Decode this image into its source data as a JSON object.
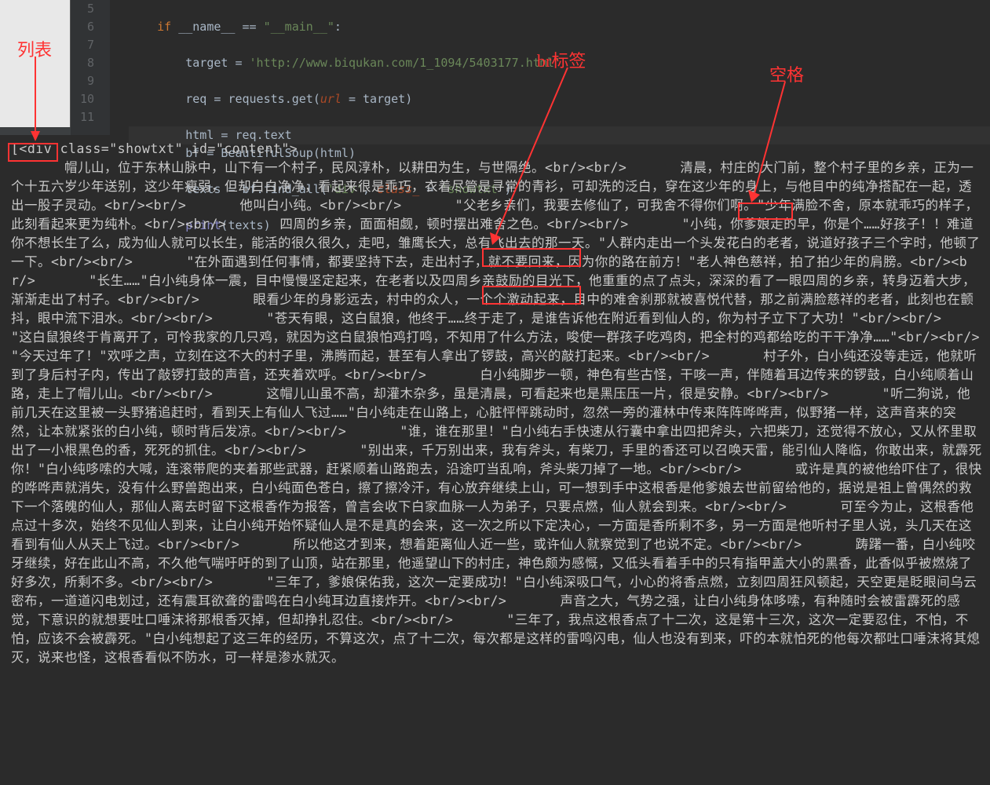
{
  "annotations": {
    "list_label": "列表",
    "br_label": "br标签",
    "space_label": "空格"
  },
  "editor": {
    "lines": {
      "l5": {
        "num": "5",
        "indent": "    ",
        "kw_if": "if",
        "name": " __name__ ",
        "eqeq": "==",
        "main": " \"__main__\"",
        "colon": ":"
      },
      "l6": {
        "num": "6",
        "indent": "        ",
        "var": "target ",
        "eq": "= ",
        "str": "'http://www.biqukan.com/1_1094/5403177.html'"
      },
      "l7": {
        "num": "7",
        "indent": "        ",
        "var": "req ",
        "eq": "= ",
        "mod": "requests",
        "dot": ".",
        "fn": "get",
        "lp": "(",
        "param": "url",
        "eq2": " = ",
        "arg": "target",
        "rp": ")"
      },
      "l8": {
        "num": "8",
        "indent": "        ",
        "var": "html ",
        "eq": "= ",
        "obj": "req",
        "dot": ".",
        "attr": "text"
      },
      "l9": {
        "num": "9",
        "indent": "        ",
        "var": "bf ",
        "eq": "= ",
        "cls": "BeautifulSoup",
        "lp": "(",
        "arg": "html",
        "rp": ")"
      },
      "l10": {
        "num": "10",
        "indent": "        ",
        "var": "texts ",
        "eq": "= ",
        "obj": "bf",
        "dot": ".",
        "fn": "find_all",
        "lp": "(",
        "s1": "'div'",
        "comma": ", ",
        "param": "class_",
        "eq2": " = ",
        "s2": "'showtxt'",
        "rp": ")"
      },
      "l11": {
        "num": "11",
        "indent": "        ",
        "fn": "print",
        "lp": "(",
        "arg": "texts",
        "rp": ")"
      }
    }
  },
  "console": {
    "open": "[<div class=\"showtxt\" id=\"content\">",
    "body_parts": [
      "　　　　帽儿山，位于东林山脉中，山下有一个村子，民风淳朴，以耕田为生，与世隔绝。<br/><br/>　　　　清晨，村庄的大门前，整个村子里的乡亲，正为一个十五六岁少年送别，这少年瘦弱，但却白白净净，看起来很是乖巧，衣着尽管是寻常的青衫，可却洗的泛白，穿在这少年的身上，与他目中的纯净搭配在一起，透出一股子灵动。<br/><br/>　　　　他叫白小纯。<br/><br/>　　　　\"父老乡亲们，我要去修仙了，可我舍不得你们啊。\"少年满脸不舍，原本就乖巧的样子，此刻看起来更为纯朴。<br/><br/>　　　　四周的乡亲，面面相觑，顿时摆出难舍之色。",
      "<br/><br/>",
      "　　　　\"小纯，你爹娘走的早，你是个……好孩子！！难道你不想长生了么，成为仙人就可以长生，能活的很久很久，走吧，雏鹰长大，总有飞出去的那一天。\"人群内走出一个头发花白的老者，说道好孩子三个字时，他顿了一下。<br/><br/>　　　　\"在外面遇到任何事情，都要坚持下去，走出村子，就不要回来，因为你的路在前方！\"老人神色慈祥，拍了拍少年的肩膀。",
      "<br/><br/>",
      "　　　　\"长生……\"白小纯身体一震，目中慢慢坚定起来，在老者以及四周乡亲鼓励的目光下，他重重的点了点头，深深的看了一眼四周的乡亲，转身迈着大步，渐渐走出了村子。<br/><br/>　　　　眼看少年的身影远去，村中的众人，一个个激动起来，目中的难舍刹那就被喜悦代替，那之前满脸慈祥的老者，此刻也在颤抖，眼中流下泪水。<br/><br/>",
      "　　　　\"苍天有眼，这白鼠狼，他终于……终于走了，是谁告诉他在附近看到仙人的，你为村子立下了大功！\"<br/><br/>　　　　\"这白鼠狼终于肯离开了，可怜我家的几只鸡，就因为这白鼠狼怕鸡打鸣，不知用了什么方法，唆使一群孩子吃鸡肉，把全村的鸡都给吃的干干净净……\"<br/><br/>",
      "　　　　\"今天过年了！\"欢呼之声，立刻在这不大的村子里，沸腾而起，甚至有人拿出了锣鼓，高兴的敲打起来。<br/><br/>　　　　村子外，白小纯还没等走远，他就听到了身后村子内，传出了敲锣打鼓的声音，还夹着欢呼。<br/><br/>　　　　白小纯脚步一顿，神色有些古怪，干咳一声，伴随着耳边传来的锣鼓，白小纯顺着山路，走上了帽儿山。<br/><br/>",
      "　　　　这帽儿山虽不高，却灌木杂多，虽是清晨，可看起来也是黑压压一片，很是安静。<br/><br/>　　　　\"听二狗说，他前几天在这里被一头野猪追赶时，看到天上有仙人飞过……\"白小纯走在山路上，心脏怦怦跳动时，忽然一旁的灌林中传来阵阵哗哗声，似野猪一样，这声音来的突然，让本就紧张的白小纯，顿时背后发凉。<br/><br/>　　　　\"谁，谁在那里！\"白小纯右手快速从行囊中拿出四把斧头，六把柴刀，还觉得不放心，又从怀里取出了一小根黑色的香，死死的抓住。<br/><br/>　　　　\"别出来，千万别出来，我有斧头，有柴刀，手里的香还可以召唤天雷，能引仙人降临，你敢出来，就霹死你！\"白小纯哆嗦的大喊，连滚带爬的夹着那些武器，赶紧顺着山路跑去，沿途叮当乱响，斧头柴刀掉了一地。<br/><br/>　　　　或许是真的被他给吓住了，很快的哗哗声就消失，没有什么野兽跑出来，白小纯面色苍白，擦了擦冷汗，有心放弃继续上山，可一想到手中这根香是他爹娘去世前留给他的，据说是祖上曾偶然的救下一个落魄的仙人，那仙人离去时留下这根香作为报答，曾言会收下白家血脉一人为弟子，只要点燃，仙人就会到来。<br/><br/>　　　　可至今为止，这根香他点过十多次，始终不见仙人到来，让白小纯开始怀疑仙人是不是真的会来，这一次之所以下定决心，一方面是香所剩不多，另一方面是他听村子里人说，头几天在这看到有仙人从天上飞过。<br/><br/>　　　　所以他这才到来，想着距离仙人近一些，或许仙人就察觉到了也说不定。<br/><br/>　　　　踌躇一番，白小纯咬牙继续，好在此山不高，不久他气喘吁吁的到了山顶，站在那里，他遥望山下的村庄，神色颇为感慨，又低头看着手中的只有指甲盖大小的黑香，此香似乎被燃烧了好多次，所剩不多。<br/><br/>　　　　\"三年了，爹娘保佑我，这次一定要成功！\"白小纯深吸口气，小心的将香点燃，立刻四周狂风顿起，天空更是眨眼间乌云密布，一道道闪电划过，还有震耳欲聋的雷鸣在白小纯耳边直接炸开。<br/><br/>　　　　声音之大，气势之强，让白小纯身体哆嗦，有种随时会被雷霹死的感觉，下意识的就想要吐口唾沫将那根香灭掉，但却挣扎忍住。<br/><br/>　　　　\"三年了，我点这根香点了十二次，这是第十三次，这次一定要忍住，不怕，不怕，应该不会被霹死。\"白小纯想起了这三年的经历，不算这次，点了十二次，每次都是这样的雷鸣闪电，仙人也没有到来，吓的本就怕死的他每次都吐口唾沫将其熄灭，说来也怪，这根香看似不防水，可一样是渗水就灭。"
    ]
  }
}
